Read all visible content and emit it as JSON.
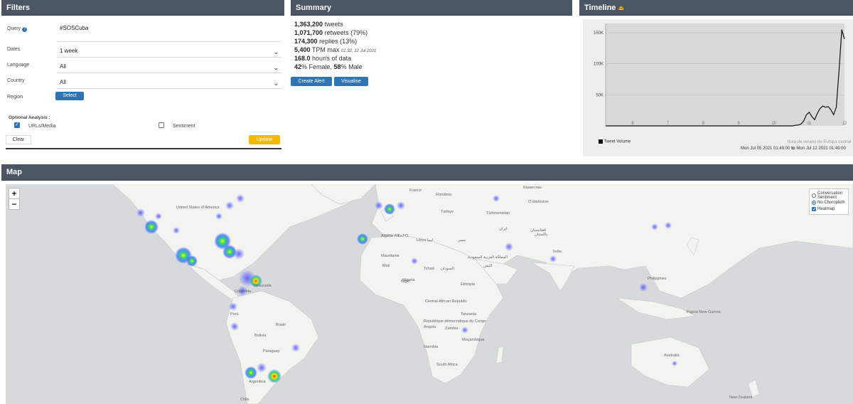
{
  "filters": {
    "title": "Filters",
    "query_label": "Query",
    "query_value": "#SOSCuba",
    "dates_label": "Dates",
    "dates_value": "1 week",
    "language_label": "Language",
    "language_value": "All",
    "country_label": "Country",
    "country_value": "All",
    "region_label": "Region",
    "region_button": "Select",
    "optional_label": "Optional Analysis :",
    "urls_label": "URLs/Media",
    "urls_checked": true,
    "sentiment_label": "Sentiment",
    "sentiment_checked": false,
    "clear_button": "Clear",
    "update_button": "Update"
  },
  "summary": {
    "title": "Summary",
    "tweets_num": "1,363,200",
    "tweets_txt": "tweets",
    "retweets_num": "1,071,700",
    "retweets_txt": "retweets (79%)",
    "replies_num": "174,300",
    "replies_txt": "replies (13%)",
    "tpm_num": "5,400",
    "tpm_txt": "TPM max",
    "tpm_time": "01:32, 12 Jul 2021",
    "hours_num": "168.0",
    "hours_txt": "hour/s of data",
    "female_num": "42",
    "female_txt": "% Female,",
    "male_num": "58",
    "male_txt": "% Male",
    "create_alert_button": "Create Alert",
    "visualise_button": "Visualise"
  },
  "timeline": {
    "title": "Timeline",
    "download_icon": "download-icon",
    "legend": "Tweet Volume",
    "timezone": "hora de verano de Europa central",
    "range_from": "Mon Jul 05 2021 01:49:00",
    "range_to_word": "to",
    "range_to": "Mon Jul 12 2021 01:49:00"
  },
  "chart_data": {
    "type": "line",
    "series": [
      {
        "name": "Tweet Volume",
        "values": [
          0,
          0,
          0,
          0,
          0,
          0,
          0,
          0,
          0,
          0,
          0,
          0,
          0,
          0,
          0,
          0,
          0,
          0,
          0,
          0,
          0,
          0,
          0,
          0,
          0,
          0,
          0,
          0,
          0,
          0,
          0,
          0,
          0,
          0,
          0,
          0,
          0,
          0,
          0,
          0,
          0,
          0,
          0,
          0,
          0,
          0,
          0,
          0,
          0,
          0,
          0,
          0,
          0,
          0,
          0,
          0,
          0,
          0,
          0,
          0,
          0,
          0,
          0,
          0,
          0,
          0,
          0,
          0,
          0,
          0,
          1000,
          1500,
          3000,
          8000,
          18000,
          22000,
          15000,
          10000,
          20000,
          28000,
          32000,
          30000,
          31000,
          26000,
          18000,
          30000,
          90000,
          155000,
          140000
        ]
      }
    ],
    "x_ticks": [
      "6",
      "7",
      "8",
      "9",
      "10",
      "11",
      "12"
    ],
    "y_ticks": [
      "50K",
      "100K",
      "150K"
    ],
    "ylim": [
      0,
      165000
    ]
  },
  "map": {
    "title": "Map",
    "zoom_in": "+",
    "zoom_out": "−",
    "options": [
      {
        "label": "Conversation Sentiment",
        "selected": false
      },
      {
        "label": "No Choropleth",
        "selected": true
      }
    ],
    "heatmap_label": "Heatmap",
    "heatmap_checked": true,
    "labels": [
      {
        "t": "United States of America"
      },
      {
        "t": "France"
      },
      {
        "t": "România"
      },
      {
        "t": "Казахстан"
      },
      {
        "t": "Türkiye"
      },
      {
        "t": "Türkmenistan"
      },
      {
        "t": "O'zbekiston"
      },
      {
        "t": "Algérie ⴷⵣⴰⵢⵔ"
      },
      {
        "t": "Libya ليبيا"
      },
      {
        "t": "مصر"
      },
      {
        "t": "ایران"
      },
      {
        "t": "افغانستان"
      },
      {
        "t": "پاکستان"
      },
      {
        "t": "Mauritanie"
      },
      {
        "t": "Mali"
      },
      {
        "t": "Niger"
      },
      {
        "t": "Tchad"
      },
      {
        "t": "السودان"
      },
      {
        "t": "المملكة العربية السعودية"
      },
      {
        "t": "اليمن"
      },
      {
        "t": "India"
      },
      {
        "t": "Nigeria"
      },
      {
        "t": "Ethiopia"
      },
      {
        "t": "Central African Republic"
      },
      {
        "t": "République démocratique du Congo"
      },
      {
        "t": "Tanzania"
      },
      {
        "t": "Angola"
      },
      {
        "t": "Zambia"
      },
      {
        "t": "Moçambique"
      },
      {
        "t": "Namibia"
      },
      {
        "t": "South Africa"
      },
      {
        "t": "Venezuela"
      },
      {
        "t": "Colombia"
      },
      {
        "t": "Perú"
      },
      {
        "t": "Brasil"
      },
      {
        "t": "Bolivia"
      },
      {
        "t": "Paraguay"
      },
      {
        "t": "Argentina"
      },
      {
        "t": "Chile"
      },
      {
        "t": "Philippines"
      },
      {
        "t": "Papua New Guinea"
      },
      {
        "t": "Australia"
      },
      {
        "t": "New Zealand"
      }
    ]
  }
}
